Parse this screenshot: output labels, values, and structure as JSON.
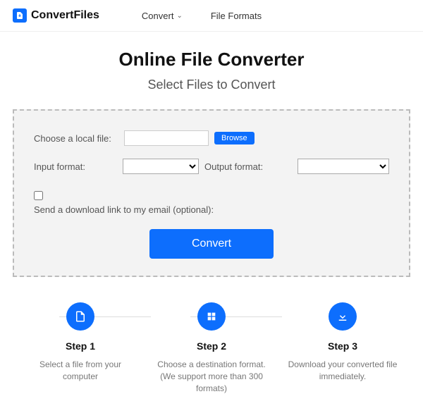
{
  "header": {
    "brand": "ConvertFiles",
    "nav": {
      "convert": "Convert",
      "formats": "File Formats"
    }
  },
  "main": {
    "title": "Online File Converter",
    "subtitle": "Select Files to Convert"
  },
  "panel": {
    "chooseLabel": "Choose a local file:",
    "browse": "Browse",
    "inputFormat": "Input format:",
    "outputFormat": "Output format:",
    "emailCheck": "Send a download link to my email (optional):",
    "convert": "Convert"
  },
  "steps": [
    {
      "title": "Step 1",
      "desc": "Select a file from your computer"
    },
    {
      "title": "Step 2",
      "desc": "Choose a destination format. (We support more than 300 formats)"
    },
    {
      "title": "Step 3",
      "desc": "Download your converted file immediately."
    }
  ]
}
